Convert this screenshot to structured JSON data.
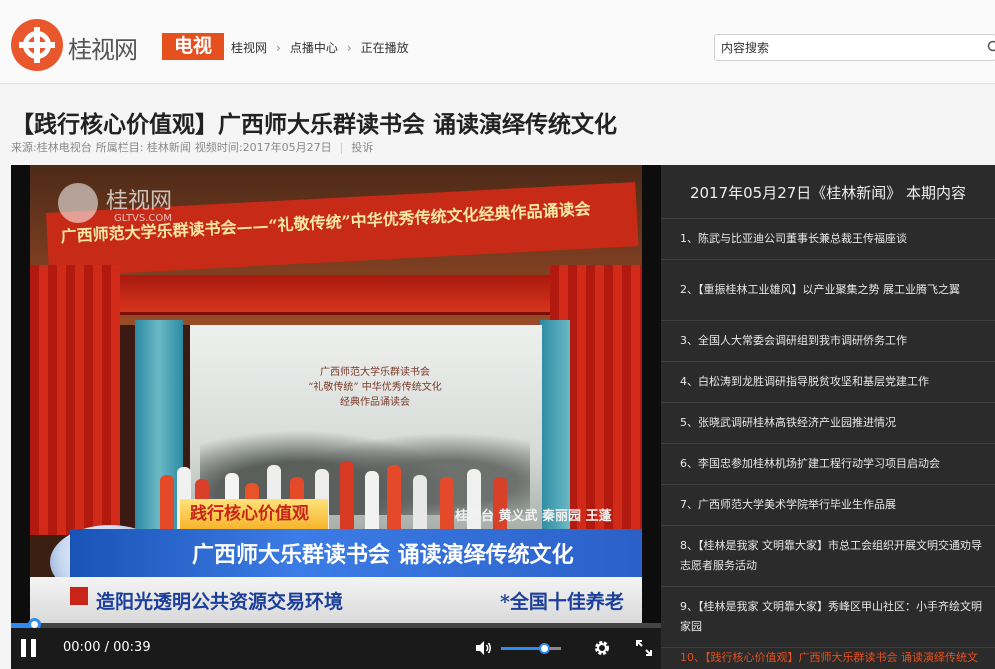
{
  "header": {
    "logo_text": "桂视网",
    "logo_tag": "电视",
    "breadcrumb": [
      "桂视网",
      "点播中心",
      "正在播放"
    ],
    "search_placeholder": "内容搜索"
  },
  "article": {
    "title": "【践行核心价值观】广西师大乐群读书会 诵读演绎传统文化",
    "meta_source": "来源:桂林电视台",
    "meta_column": "所属栏目: 桂林新闻",
    "meta_time": "视频时间:2017年05月27日",
    "meta_complain": "投诉"
  },
  "video": {
    "watermark": "桂视网",
    "watermark_sub": "GLTVS.COM",
    "banner_text": "广西师范大学乐群读书会——“礼敬传统”中华优秀传统文化经典作品诵读会",
    "scroll_lines": [
      "广西师范大学乐群读书会",
      "“礼敬传统” 中华优秀传统文化",
      "经典作品诵读会"
    ],
    "caption_tag": "践行核心价值观",
    "caption_credits": "桂林台 黄义武 秦丽园 王蓬",
    "caption_main": "广西师大乐群读书会 诵读演绎传统文化",
    "ticker_left": "造阳光透明公共资源交易环境",
    "ticker_right": "*全国十佳养老"
  },
  "player": {
    "time_current": "00:00",
    "time_total": "00:39",
    "progress_fraction": 0.035,
    "volume_fraction": 0.72
  },
  "sidebar": {
    "heading": "2017年05月27日《桂林新闻》 本期内容",
    "items": [
      {
        "label": "1、陈武与比亚迪公司董事长兼总裁王传福座谈",
        "lines": 1
      },
      {
        "label": "2、【重振桂林工业雄风】以产业聚集之势 展工业腾飞之翼",
        "lines": 2
      },
      {
        "label": "3、全国人大常委会调研组到我市调研侨务工作",
        "lines": 1
      },
      {
        "label": "4、白松涛到龙胜调研指导脱贫攻坚和基层党建工作",
        "lines": 1
      },
      {
        "label": "5、张晓武调研桂林高铁经济产业园推进情况",
        "lines": 1
      },
      {
        "label": "6、李国忠参加桂林机场扩建工程行动学习项目启动会",
        "lines": 1
      },
      {
        "label": "7、广西师范大学美术学院举行毕业生作品展",
        "lines": 1
      },
      {
        "label": "8、【桂林是我家 文明靠大家】市总工会组织开展文明交通劝导志愿者服务活动",
        "lines": 2
      },
      {
        "label": "9、【桂林是我家 文明靠大家】秀峰区甲山社区：小手齐绘文明家园",
        "lines": 2
      },
      {
        "label": "10、【践行核心价值观】广西师大乐群读书会 诵读演绎传统文化",
        "lines": 1,
        "active": true
      }
    ]
  },
  "colors": {
    "brand_orange": "#e5501e",
    "progress_blue": "#2f8bf0",
    "sidebar_bg": "#2b2b2b"
  }
}
